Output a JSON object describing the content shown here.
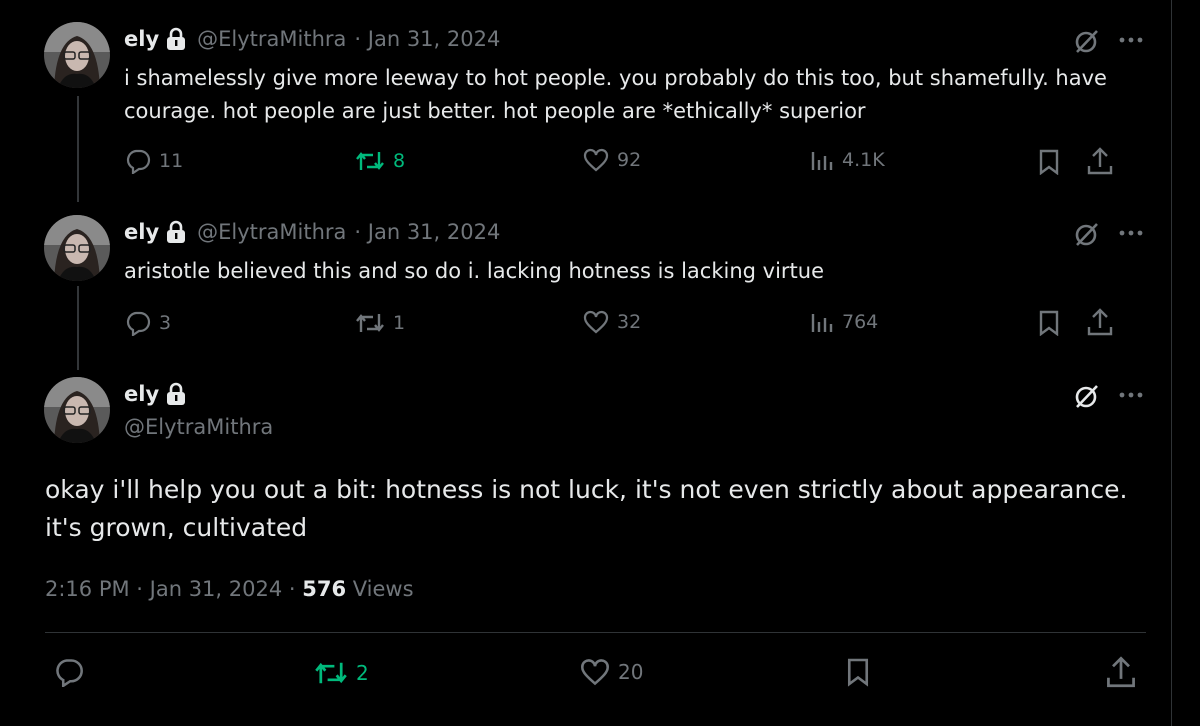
{
  "tweets": [
    {
      "name": "ely",
      "handle": "@ElytraMithra",
      "date": "· Jan 31, 2024",
      "text": "i shamelessly give more leeway to hot people. you probably do this too, but shamefully. have courage. hot people are just better. hot people are *ethically* superior",
      "replies": "11",
      "reposts": "8",
      "likes": "92",
      "views": "4.1K"
    },
    {
      "name": "ely",
      "handle": "@ElytraMithra",
      "date": "· Jan 31, 2024",
      "text": "aristotle believed this and so do i. lacking hotness is lacking virtue",
      "replies": "3",
      "reposts": "1",
      "likes": "32",
      "views": "764"
    }
  ],
  "main": {
    "name": "ely",
    "handle": "@ElytraMithra",
    "text": "okay i'll help you out a bit: hotness is not luck, it's not even strictly about appearance. it's grown, cultivated",
    "time": "2:16 PM · Jan 31, 2024 · ",
    "views_count": "576",
    "views_label": " Views",
    "reposts": "2",
    "likes": "20"
  },
  "colors": {
    "repost_active": "#00ba7c",
    "muted": "#71767b",
    "text": "#e7e9ea"
  }
}
